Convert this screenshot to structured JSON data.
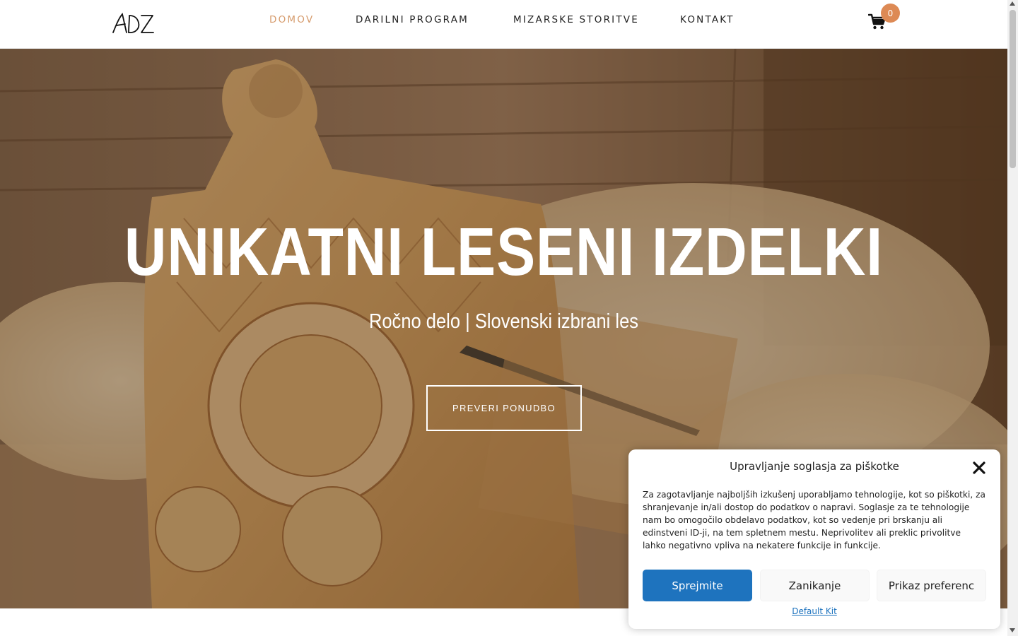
{
  "header": {
    "logo_text": "ADZ",
    "nav": [
      {
        "label": "DOMOV",
        "active": true
      },
      {
        "label": "DARILNI PROGRAM",
        "active": false
      },
      {
        "label": "MIZARSKE STORITVE",
        "active": false
      },
      {
        "label": "KONTAKT",
        "active": false
      }
    ],
    "cart_icon": "cart-icon",
    "cart_count": "0"
  },
  "hero": {
    "title": "UNIKATNI LESENI IZDELKI",
    "subtitle": "Ročno delo | Slovenski izbrani les",
    "button_label": "PREVERI PONUDBO"
  },
  "cookie": {
    "title": "Upravljanje soglasja za piškotke",
    "close_icon": "close-icon",
    "text": "Za zagotavljanje najboljših izkušenj uporabljamo tehnologije, kot so piškotki, za shranjevanje in/ali dostop do podatkov o napravi. Soglasje za te tehnologije nam bo omogočilo obdelavo podatkov, kot so vedenje pri brskanju ali edinstveni ID-ji, na tem spletnem mestu. Neprivolitev ali preklic privolitve lahko negativno vpliva na nekatere funkcije in funkcije.",
    "accept_label": "Sprejmite",
    "deny_label": "Zanikanje",
    "prefs_label": "Prikaz preferenc",
    "link_label": "Default Kit"
  },
  "colors": {
    "accent": "#d69b6c",
    "badge": "#dd8a55",
    "primary_button": "#1e73be"
  }
}
